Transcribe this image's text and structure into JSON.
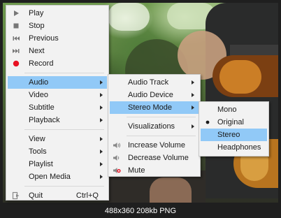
{
  "caption": "488x360 208kb PNG",
  "main_menu": [
    {
      "label": "Play",
      "icon": "play-icon",
      "kind": "item"
    },
    {
      "label": "Stop",
      "icon": "stop-icon",
      "kind": "item"
    },
    {
      "label": "Previous",
      "icon": "previous-icon",
      "kind": "item"
    },
    {
      "label": "Next",
      "icon": "next-icon",
      "kind": "item"
    },
    {
      "label": "Record",
      "icon": "record-icon",
      "kind": "item"
    },
    {
      "kind": "separator"
    },
    {
      "label": "Audio",
      "kind": "submenu",
      "highlighted": true
    },
    {
      "label": "Video",
      "kind": "submenu"
    },
    {
      "label": "Subtitle",
      "kind": "submenu"
    },
    {
      "label": "Playback",
      "kind": "submenu"
    },
    {
      "kind": "separator"
    },
    {
      "label": "View",
      "kind": "submenu"
    },
    {
      "label": "Tools",
      "kind": "submenu"
    },
    {
      "label": "Playlist",
      "kind": "submenu"
    },
    {
      "label": "Open Media",
      "kind": "submenu"
    },
    {
      "kind": "separator"
    },
    {
      "label": "Quit",
      "icon": "quit-icon",
      "shortcut": "Ctrl+Q",
      "kind": "item"
    }
  ],
  "audio_menu": [
    {
      "label": "Audio Track",
      "kind": "submenu"
    },
    {
      "label": "Audio Device",
      "kind": "submenu"
    },
    {
      "label": "Stereo Mode",
      "kind": "submenu",
      "highlighted": true
    },
    {
      "kind": "separator"
    },
    {
      "label": "Visualizations",
      "kind": "submenu"
    },
    {
      "kind": "separator"
    },
    {
      "label": "Increase Volume",
      "icon": "volume-up-icon",
      "kind": "item"
    },
    {
      "label": "Decrease Volume",
      "icon": "volume-down-icon",
      "kind": "item"
    },
    {
      "label": "Mute",
      "icon": "mute-icon",
      "kind": "item"
    }
  ],
  "stereo_menu": [
    {
      "label": "Mono",
      "kind": "item"
    },
    {
      "label": "Original",
      "kind": "item",
      "checked": true
    },
    {
      "label": "Stereo",
      "kind": "item",
      "highlighted": true
    },
    {
      "label": "Headphones",
      "kind": "item"
    }
  ],
  "colors": {
    "highlight": "#91c9f7",
    "menu_bg": "#f2f2f2",
    "record_red": "#e81123"
  }
}
